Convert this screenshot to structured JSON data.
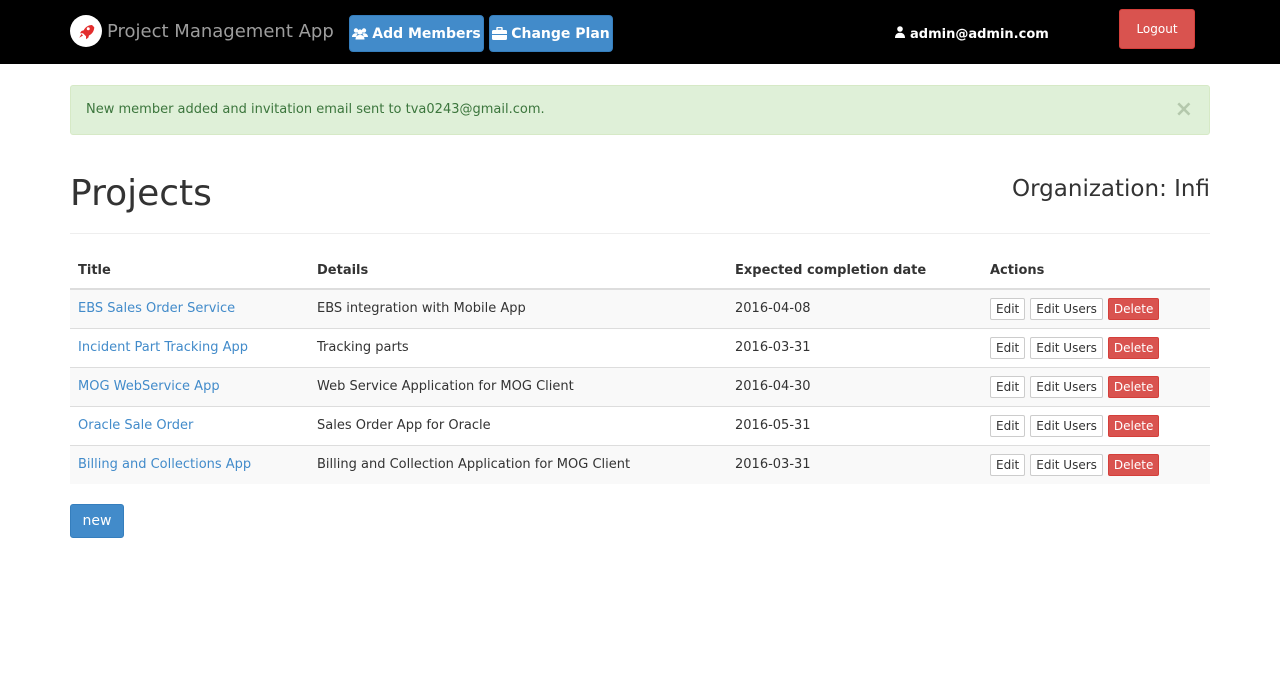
{
  "navbar": {
    "brand_text": "Project Management App",
    "add_members_label": "Add Members",
    "change_plan_label": "Change Plan",
    "user_email": "admin@admin.com",
    "logout_label": "Logout",
    "icons": {
      "brand": "rocket-icon",
      "add_members": "users-icon",
      "change_plan": "briefcase-icon",
      "user": "user-icon"
    }
  },
  "alert": {
    "message": "New member added and invitation email sent to tva0243@gmail.com.",
    "close_symbol": "×"
  },
  "page": {
    "title": "Projects",
    "organization_label": "Organization:",
    "organization_name": "Infi"
  },
  "table": {
    "headers": {
      "title": "Title",
      "details": "Details",
      "date": "Expected completion date",
      "actions": "Actions"
    },
    "rows": [
      {
        "title": "EBS Sales Order Service",
        "details": "EBS integration with Mobile App",
        "date": "2016-04-08"
      },
      {
        "title": "Incident Part Tracking App",
        "details": "Tracking parts",
        "date": "2016-03-31"
      },
      {
        "title": "MOG WebService App",
        "details": "Web Service Application for MOG Client",
        "date": "2016-04-30"
      },
      {
        "title": "Oracle Sale Order",
        "details": "Sales Order App for Oracle",
        "date": "2016-05-31"
      },
      {
        "title": "Billing and Collections App",
        "details": "Billing and Collection Application for MOG Client",
        "date": "2016-03-31"
      }
    ],
    "action_labels": {
      "edit": "Edit",
      "edit_users": "Edit Users",
      "delete": "Delete"
    }
  },
  "new_button_label": "new",
  "colors": {
    "navbar_bg": "#000000",
    "primary": "#428bca",
    "danger": "#d9534f",
    "alert_bg": "#dff0d8",
    "alert_text": "#3c763d",
    "link": "#428bca"
  }
}
